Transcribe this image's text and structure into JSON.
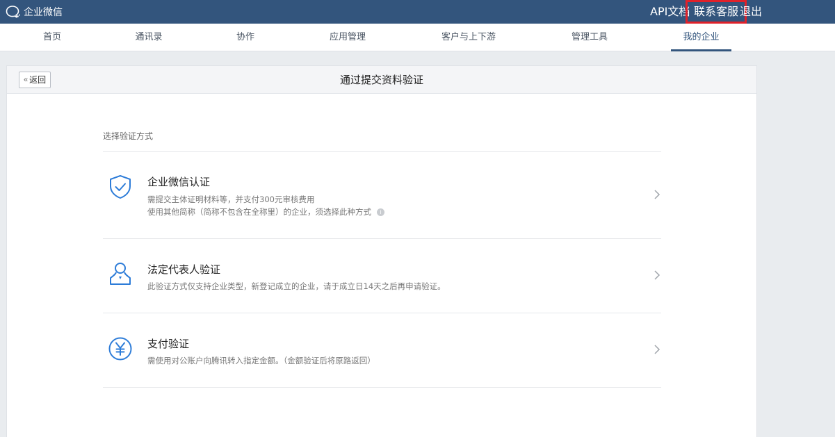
{
  "header": {
    "brand": "企业微信",
    "links": {
      "api_docs": "API文档",
      "contact_support": "联系客服",
      "logout": "退出"
    },
    "colors": {
      "bar": "#33557d",
      "highlight": "#e0212a"
    }
  },
  "nav": {
    "items": [
      {
        "label": "首页"
      },
      {
        "label": "通讯录"
      },
      {
        "label": "协作"
      },
      {
        "label": "应用管理"
      },
      {
        "label": "客户与上下游"
      },
      {
        "label": "管理工具"
      },
      {
        "label": "我的企业",
        "active": true
      }
    ]
  },
  "panel": {
    "back_label": "返回",
    "title": "通过提交资料验证",
    "section_label": "选择验证方式",
    "options": [
      {
        "icon": "shield-check-icon",
        "title": "企业微信认证",
        "desc": [
          "需提交主体证明材料等，并支付300元审核费用",
          "使用其他简称（简称不包含在全称里）的企业，须选择此种方式"
        ]
      },
      {
        "icon": "person-icon",
        "title": "法定代表人验证",
        "desc": [
          "此验证方式仅支持企业类型，新登记成立的企业，请于成立日14天之后再申请验证。"
        ]
      },
      {
        "icon": "yen-icon",
        "title": "支付验证",
        "desc": [
          "需使用对公账户向腾讯转入指定金额。（金额验证后将原路返回）"
        ]
      }
    ],
    "accent": "#2d7cd8"
  }
}
